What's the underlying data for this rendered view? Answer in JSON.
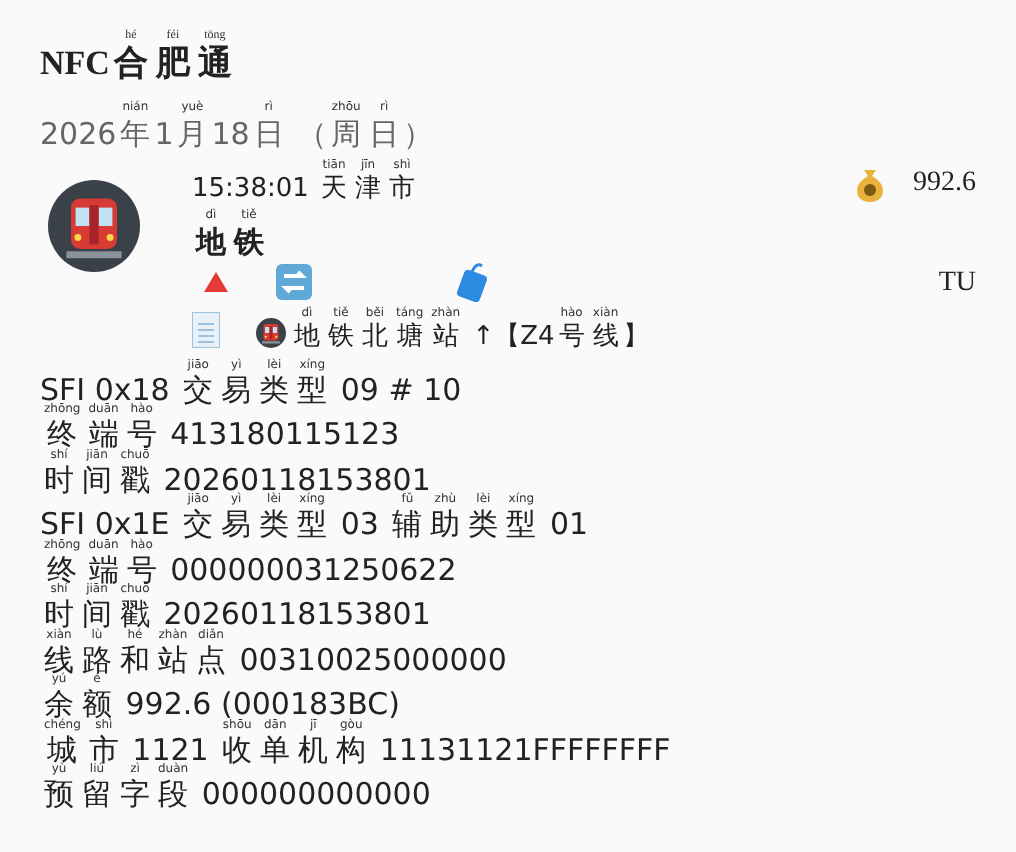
{
  "title": [
    {
      "t": "NFC"
    },
    {
      "t": "合",
      "py": "hé"
    },
    {
      "t": "肥",
      "py": "féi"
    },
    {
      "t": "通",
      "py": "tōng"
    }
  ],
  "date": [
    {
      "t": "2026"
    },
    {
      "t": "年",
      "py": "nián"
    },
    {
      "t": "1"
    },
    {
      "t": "月",
      "py": "yuè"
    },
    {
      "t": "18"
    },
    {
      "t": "日",
      "py": "rì"
    },
    {
      "t": " （"
    },
    {
      "t": "周",
      "py": "zhōu"
    },
    {
      "t": "日",
      "py": "rì"
    },
    {
      "t": "）"
    }
  ],
  "trip": {
    "time": [
      {
        "t": "15:38:01 "
      },
      {
        "t": "天",
        "py": "tiān"
      },
      {
        "t": "津",
        "py": "jīn"
      },
      {
        "t": "市",
        "py": "shì"
      }
    ],
    "balance": "992.6",
    "type": [
      {
        "t": "地",
        "py": "dì"
      },
      {
        "t": "铁",
        "py": "tiě"
      }
    ],
    "tag": "TU",
    "station": [
      {
        "t": "地",
        "py": "dì"
      },
      {
        "t": "铁",
        "py": "tiě"
      },
      {
        "t": "北",
        "py": "běi"
      },
      {
        "t": "塘",
        "py": "táng"
      },
      {
        "t": "站",
        "py": "zhàn"
      },
      {
        "t": " ↑【Z4"
      },
      {
        "t": "号",
        "py": "hào"
      },
      {
        "t": "线",
        "py": "xiàn"
      },
      {
        "t": "】"
      }
    ]
  },
  "records": [
    [
      {
        "t": "SFI 0x18 "
      },
      {
        "t": "交",
        "py": "jiāo"
      },
      {
        "t": "易",
        "py": "yì"
      },
      {
        "t": "类",
        "py": "lèi"
      },
      {
        "t": "型",
        "py": "xíng"
      },
      {
        "t": " 09 # 10"
      }
    ],
    [
      {
        "t": "终",
        "py": "zhōng"
      },
      {
        "t": "端",
        "py": "duān"
      },
      {
        "t": "号",
        "py": "hào"
      },
      {
        "t": " 413180115123"
      }
    ],
    [
      {
        "t": "时",
        "py": "shí"
      },
      {
        "t": "间",
        "py": "jiān"
      },
      {
        "t": "戳",
        "py": "chuō"
      },
      {
        "t": " 20260118153801"
      }
    ],
    [
      {
        "t": "SFI 0x1E "
      },
      {
        "t": "交",
        "py": "jiāo"
      },
      {
        "t": "易",
        "py": "yì"
      },
      {
        "t": "类",
        "py": "lèi"
      },
      {
        "t": "型",
        "py": "xíng"
      },
      {
        "t": " 03 "
      },
      {
        "t": "辅",
        "py": "fǔ"
      },
      {
        "t": "助",
        "py": "zhù"
      },
      {
        "t": "类",
        "py": "lèi"
      },
      {
        "t": "型",
        "py": "xíng"
      },
      {
        "t": " 01"
      }
    ],
    [
      {
        "t": "终",
        "py": "zhōng"
      },
      {
        "t": "端",
        "py": "duān"
      },
      {
        "t": "号",
        "py": "hào"
      },
      {
        "t": " 000000031250622"
      }
    ],
    [
      {
        "t": "时",
        "py": "shí"
      },
      {
        "t": "间",
        "py": "jiān"
      },
      {
        "t": "戳",
        "py": "chuō"
      },
      {
        "t": " 20260118153801"
      }
    ],
    [
      {
        "t": "线",
        "py": "xiàn"
      },
      {
        "t": "路",
        "py": "lù"
      },
      {
        "t": "和",
        "py": "hé"
      },
      {
        "t": "站",
        "py": "zhàn"
      },
      {
        "t": "点",
        "py": "diǎn"
      },
      {
        "t": " 00310025000000"
      }
    ],
    [
      {
        "t": "余",
        "py": "yú"
      },
      {
        "t": "额",
        "py": "é"
      },
      {
        "t": " 992.6 (000183BC)"
      }
    ],
    [
      {
        "t": "城",
        "py": "chéng"
      },
      {
        "t": "市",
        "py": "shì"
      },
      {
        "t": " 1121 "
      },
      {
        "t": "收",
        "py": "shōu"
      },
      {
        "t": "单",
        "py": "dān"
      },
      {
        "t": "机",
        "py": "jī"
      },
      {
        "t": "构",
        "py": "gòu"
      },
      {
        "t": " 11131121FFFFFFFF"
      }
    ],
    [
      {
        "t": "预",
        "py": "yù"
      },
      {
        "t": "留",
        "py": "liú"
      },
      {
        "t": "字",
        "py": "zì"
      },
      {
        "t": "段",
        "py": "duàn"
      },
      {
        "t": " 000000000000"
      }
    ]
  ]
}
